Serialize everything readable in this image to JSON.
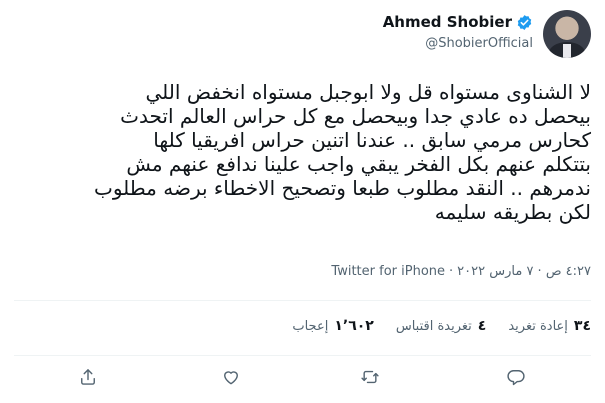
{
  "author": {
    "name": "Ahmed Shobier",
    "handle": "@ShobierOfficial",
    "verified": true
  },
  "tweet": {
    "lines": [
      "لا الشناوى مستواه قل ولا ابوجبل مستواه انخفض اللي",
      "بيحصل ده عادي جدا وبيحصل مع كل حراس العالم اتحدث",
      "كحارس مرمي سابق .. عندنا اتنين حراس افريقيا كلها",
      "بتتكلم عنهم بكل الفخر يبقي واجب علينا ندافع عنهم مش",
      "ندمرهم .. النقد مطلوب طبعا وتصحيح الاخطاء برضه مطلوب",
      "لكن بطريقه سليمه"
    ],
    "timestamp": "٤:٢٧ ص · ٧ مارس ٢٠٢٢",
    "separator": "·",
    "source": "Twitter for iPhone"
  },
  "stats": {
    "retweets": {
      "count": "٣٤",
      "label": "إعادة تغريد"
    },
    "quotes": {
      "count": "٤",
      "label": "تغريدة اقتباس"
    },
    "likes": {
      "count": "١٬٦٠٢",
      "label": "إعجاب"
    }
  },
  "actions": [
    "reply-icon",
    "retweet-icon",
    "like-icon",
    "share-icon"
  ],
  "colors": {
    "verified": "#1d9bf0",
    "secondary_text": "#536471",
    "text": "#0f1419"
  }
}
